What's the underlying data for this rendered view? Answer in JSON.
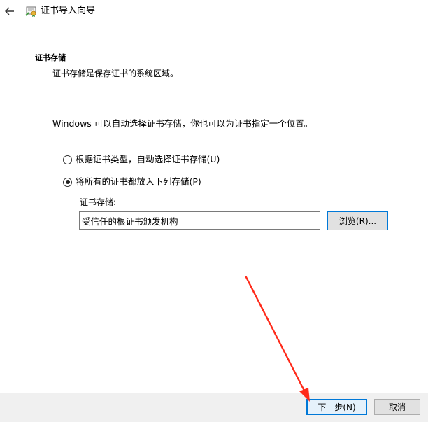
{
  "window": {
    "title": "证书导入向导"
  },
  "header": {
    "section_title": "证书存储",
    "section_desc": "证书存储是保存证书的系统区域。"
  },
  "main": {
    "intro": "Windows 可以自动选择证书存储，你也可以为证书指定一个位置。",
    "options": [
      {
        "label": "根据证书类型，自动选择证书存储(U)",
        "checked": false
      },
      {
        "label": "将所有的证书都放入下列存储(P)",
        "checked": true
      }
    ],
    "store_label": "证书存储:",
    "store_value": "受信任的根证书颁发机构",
    "browse_label": "浏览(R)..."
  },
  "footer": {
    "next_label": "下一步(N)",
    "cancel_label": "取消"
  },
  "colors": {
    "accent": "#0078d7",
    "annotation_arrow": "#ff2a1a",
    "footer_bg": "#f0f0f0"
  },
  "icons": {
    "back": "arrow-left-icon",
    "app": "certificate-icon"
  }
}
